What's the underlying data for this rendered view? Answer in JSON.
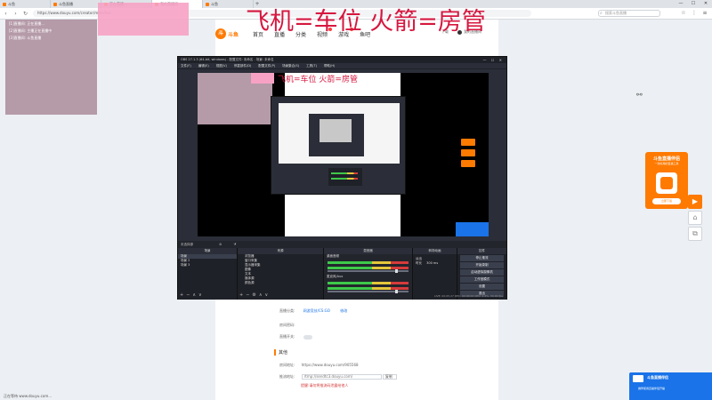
{
  "browser": {
    "tabs": [
      {
        "label": "斗鱼",
        "active": false
      },
      {
        "label": "斗鱼直播",
        "active": false
      },
      {
        "label": "正在直播...",
        "active": false
      },
      {
        "label": "我的直播间",
        "active": true
      },
      {
        "label": "斗鱼",
        "active": false
      }
    ],
    "new_tab": "+",
    "controls": [
      "—",
      "☐",
      "✕"
    ],
    "url": "https://www.douyu.com/creator/main/live",
    "search_placeholder": "搜索斗鱼直播",
    "tool_icons": [
      "☆",
      "⋮",
      "≡"
    ]
  },
  "banner": {
    "text": "飞机=车位  火箭=房管"
  },
  "overlay_panel": {
    "lines": [
      "[1]直播间: 正在直播...",
      "[2]直播间: 主播正在直播中",
      "[3]直播间: 斗鱼直播"
    ]
  },
  "site": {
    "logo_mark": "斗",
    "logo_word": "斗鱼",
    "nav": [
      {
        "label": "首页",
        "hot": false
      },
      {
        "label": "直播",
        "hot": false
      },
      {
        "label": "分类",
        "hot": false
      },
      {
        "label": "视频",
        "hot": true
      },
      {
        "label": "游戏",
        "hot": true
      },
      {
        "label": "鱼吧",
        "hot": false
      }
    ],
    "header_right": [
      "下载",
      "我的直播间"
    ]
  },
  "form": {
    "category_label": "直播分类:",
    "category_value": "网游竞技/CS:GO",
    "category_link": "修改",
    "password_label": "房间密码:",
    "toggle_label": "直播开关:",
    "section_title": "其他",
    "room_url_label": "房间地址:",
    "room_url": "https://www.douyu.com/905568",
    "push_url_label": "推流地址:",
    "push_url_value": "rtmp://sendtc3.douyu.com/",
    "copy_btn": "复制",
    "hint": "提醒:请勿将推流码泄露给他人"
  },
  "promo": {
    "title": "斗鱼直播伴侣",
    "subtitle": "一款好用的直播工具",
    "button": "立即下载"
  },
  "side_buttons": [
    "▶",
    "⌂",
    "⧉"
  ],
  "notice": {
    "title": "斗鱼直播伴侣",
    "body": "推荐使用直播伴侣开播"
  },
  "status_text": "正在等待 www.douyu.com...",
  "obs": {
    "title": "OBS 27.1.3 (64-bit, windows) - 配置文件: 未命名 - 场景: 未命名",
    "menu": [
      "文件(F)",
      "编辑(E)",
      "视图(V)",
      "停靠部件(D)",
      "配置文件(P)",
      "场景集合(S)",
      "工具(T)",
      "帮助(H)"
    ],
    "dock_strip": "未选择源",
    "scenes": {
      "header": "场景",
      "items": [
        "场景",
        "场景 2",
        "场景 3"
      ]
    },
    "sources": {
      "header": "来源",
      "items": [
        "浏览器",
        "窗口采集",
        "显示器采集",
        "图像",
        "文本",
        "媒体源",
        "颜色源"
      ]
    },
    "mixer": {
      "header": "混音器",
      "channels": [
        "桌面音频",
        "麦克风/Aux"
      ]
    },
    "transitions": {
      "header": "转场动画",
      "type": "淡出",
      "duration_label": "时长",
      "duration": "300 ms"
    },
    "controls": {
      "header": "控件",
      "buttons": [
        "停止推流",
        "开始录制",
        "启动虚拟摄像机",
        "工作室模式",
        "设置",
        "退出"
      ]
    },
    "status": "LIVE: 00:05:27  REC: 00:00:00  CPU: 2.4%, 30.00 fps"
  }
}
